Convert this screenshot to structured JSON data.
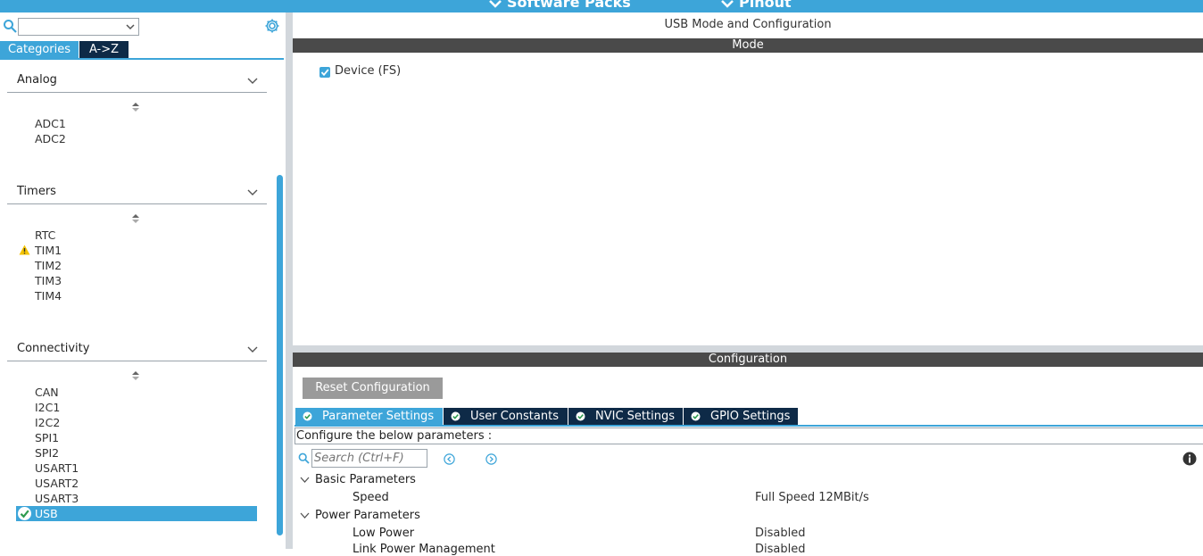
{
  "topbar": {
    "software_packs": "Software Packs",
    "pinout": "Pinout"
  },
  "sidebar": {
    "category_select_value": "",
    "tabs": [
      {
        "label": "Categories"
      },
      {
        "label": "A->Z"
      }
    ],
    "sections": [
      {
        "title": "Analog",
        "items": [
          "ADC1",
          "ADC2"
        ]
      },
      {
        "title": "Timers",
        "items": [
          "RTC",
          "TIM1",
          "TIM2",
          "TIM3",
          "TIM4"
        ]
      },
      {
        "title": "Connectivity",
        "items": [
          "CAN",
          "I2C1",
          "I2C2",
          "SPI1",
          "SPI2",
          "USART1",
          "USART2",
          "USART3",
          "USB"
        ]
      }
    ],
    "warning_item": "TIM1",
    "selected_item": "USB"
  },
  "main": {
    "title": "USB Mode and Configuration",
    "mode_header": "Mode",
    "mode_checkbox": {
      "label": "Device (FS)",
      "checked": true
    },
    "config_header": "Configuration",
    "reset_button": "Reset Configuration",
    "config_tabs": [
      {
        "label": "Parameter Settings",
        "active": true
      },
      {
        "label": "User Constants"
      },
      {
        "label": "NVIC Settings"
      },
      {
        "label": "GPIO Settings"
      }
    ],
    "configure_text": "Configure the below parameters :",
    "search_placeholder": "Search (Ctrl+F)",
    "param_groups": [
      {
        "name": "Basic Parameters",
        "params": [
          {
            "name": "Speed",
            "value": "Full Speed 12MBit/s"
          }
        ]
      },
      {
        "name": "Power Parameters",
        "params": [
          {
            "name": "Low Power",
            "value": "Disabled"
          },
          {
            "name": "Link Power Management",
            "value": "Disabled"
          }
        ]
      }
    ]
  },
  "colors": {
    "accent": "#3da5d9",
    "dark_tab": "#0e2a47",
    "header_bar": "#4a4a4a",
    "warning": "#f5c400"
  }
}
